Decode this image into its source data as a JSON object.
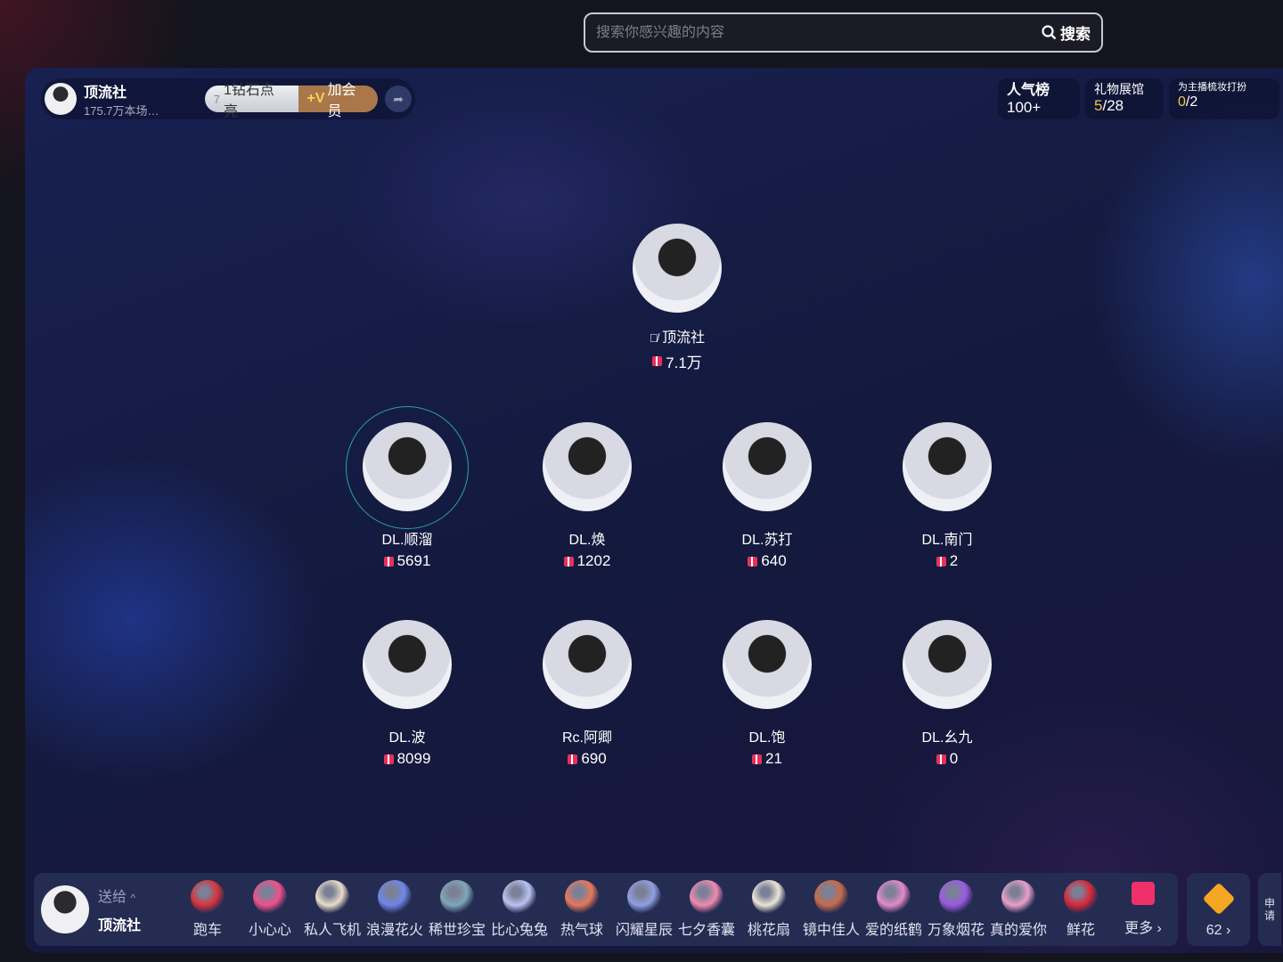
{
  "search": {
    "placeholder": "搜索你感兴趣的内容",
    "button": "搜索"
  },
  "room": {
    "name": "顶流社",
    "subtitle": "175.7万本场…",
    "diamond_label": "1钻石点亮",
    "diamond_level": "7",
    "vip_label": "加会员"
  },
  "top_right": [
    {
      "title": "人气榜",
      "value": "100+"
    },
    {
      "title": "礼物展馆",
      "value_highlight": "5",
      "value_rest": "/28"
    },
    {
      "title": "为主播梳妆打扮",
      "value_highlight": "0",
      "value_rest": "/2"
    }
  ],
  "host_seat": {
    "name": "顶流社",
    "score": "7.1万",
    "mic": "muted"
  },
  "seats": [
    {
      "name": "DL.顺溜",
      "score": "5691",
      "speaking": true
    },
    {
      "name": "DL.焕",
      "score": "1202"
    },
    {
      "name": "DL.苏打",
      "score": "640"
    },
    {
      "name": "DL.南门",
      "score": "2"
    },
    {
      "name": "DL.波",
      "score": "8099"
    },
    {
      "name": "Rc.阿卿",
      "score": "690"
    },
    {
      "name": "DL.饱",
      "score": "21"
    },
    {
      "name": "DL.幺九",
      "score": "0"
    }
  ],
  "giftbar": {
    "send_to_label": "送给",
    "recipient": "顶流社",
    "gifts": [
      {
        "name": "跑车",
        "color": "#d8333a"
      },
      {
        "name": "小心心",
        "color": "#f0508a"
      },
      {
        "name": "私人飞机",
        "color": "#e8dcc8"
      },
      {
        "name": "浪漫花火",
        "color": "#6f86e8"
      },
      {
        "name": "稀世珍宝",
        "color": "#7fa7b8"
      },
      {
        "name": "比心兔兔",
        "color": "#b9c3f2"
      },
      {
        "name": "热气球",
        "color": "#e8785a"
      },
      {
        "name": "闪耀星辰",
        "color": "#8fa0e0"
      },
      {
        "name": "七夕香囊",
        "color": "#f08ab0"
      },
      {
        "name": "桃花扇",
        "color": "#ece4d6"
      },
      {
        "name": "镜中佳人",
        "color": "#c86a48"
      },
      {
        "name": "爱的纸鹤",
        "color": "#e48ac8"
      },
      {
        "name": "万象烟花",
        "color": "#9a5ae0"
      },
      {
        "name": "真的爱你",
        "color": "#e8a0c8"
      },
      {
        "name": "鲜花",
        "color": "#d82838"
      }
    ],
    "more_label": "更多",
    "coins": "62",
    "apply_label": "申请"
  }
}
